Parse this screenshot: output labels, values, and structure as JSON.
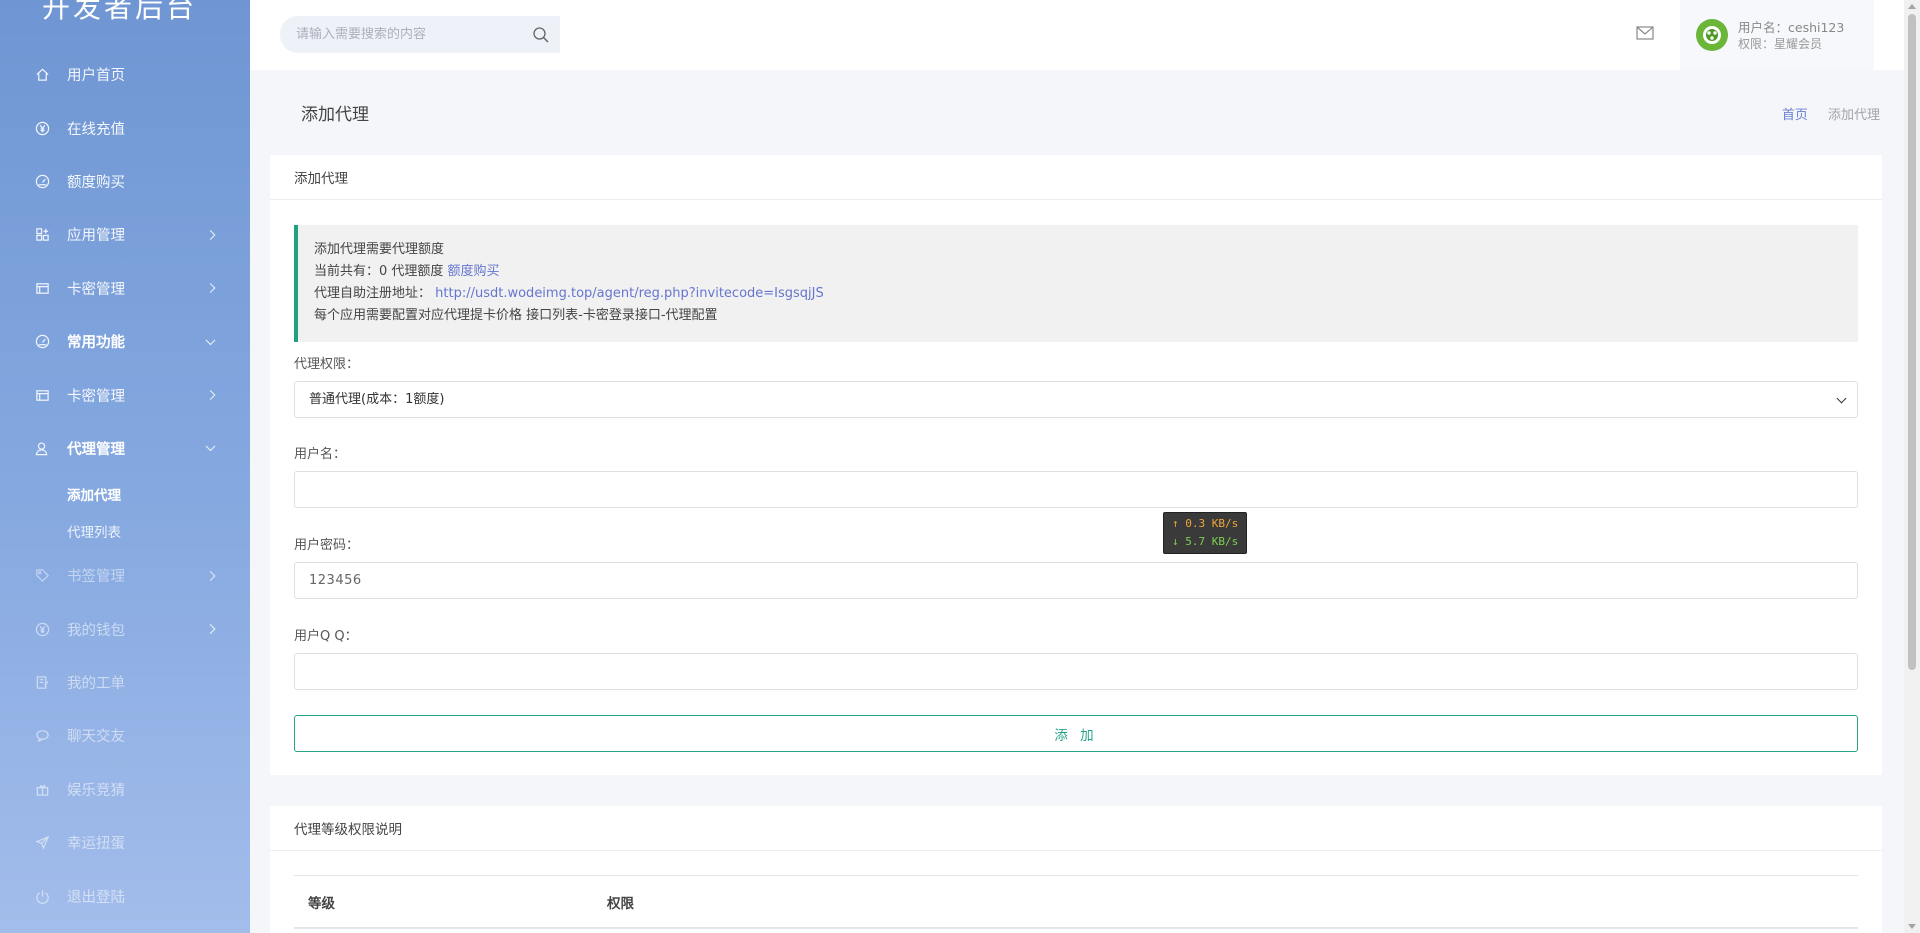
{
  "sidebar": {
    "brand": "开发者后台",
    "items": [
      {
        "label": "用户首页",
        "icon": "home-icon"
      },
      {
        "label": "在线充值",
        "icon": "yen-icon"
      },
      {
        "label": "额度购买",
        "icon": "gauge-icon"
      },
      {
        "label": "应用管理",
        "icon": "apps-icon"
      },
      {
        "label": "卡密管理",
        "icon": "card-icon"
      },
      {
        "label": "常用功能",
        "icon": "gauge-icon"
      },
      {
        "label": "卡密管理",
        "icon": "card-icon"
      },
      {
        "label": "代理管理",
        "icon": "user-icon"
      },
      {
        "label": "书签管理",
        "icon": "tag-icon"
      },
      {
        "label": "我的钱包",
        "icon": "wallet-icon"
      },
      {
        "label": "我的工单",
        "icon": "ticket-icon"
      },
      {
        "label": "聊天交友",
        "icon": "chat-icon"
      },
      {
        "label": "娱乐竞猜",
        "icon": "gift-icon"
      },
      {
        "label": "幸运扭蛋",
        "icon": "send-icon"
      },
      {
        "label": "退出登陆",
        "icon": "power-icon"
      }
    ],
    "sub_items": [
      {
        "label": "添加代理"
      },
      {
        "label": "代理列表"
      }
    ]
  },
  "header": {
    "search_placeholder": "请输入需要搜索的内容",
    "username": "用户名：ceshi123",
    "role": "权限：星耀会员"
  },
  "page": {
    "title": "添加代理",
    "breadcrumb_home": "首页",
    "breadcrumb_current": "添加代理"
  },
  "form_card": {
    "title": "添加代理",
    "notice": {
      "line1": "添加代理需要代理额度",
      "line2_prefix": "当前共有：0 代理额度 ",
      "line2_link": "额度购买",
      "line3_prefix": "代理自助注册地址：",
      "line3_link": "http://usdt.wodeimg.top/agent/reg.php?invitecode=IsgsqjJS",
      "line4": "每个应用需要配置对应代理提卡价格 接口列表-卡密登录接口-代理配置"
    },
    "level_label": "代理权限：",
    "level_selected": "普通代理(成本：1额度)",
    "username_label": "用户名：",
    "username_value": "",
    "password_label": "用户密码：",
    "password_value": "123456",
    "qq_label": "用户Q Q：",
    "qq_value": "",
    "submit_label": "添 加"
  },
  "level_card": {
    "title": "代理等级权限说明",
    "columns": [
      "等级",
      "权限"
    ]
  },
  "speed_overlay": {
    "up": "↑ 0.3 KB/s",
    "down": "↓ 5.7 KB/s"
  },
  "colors": {
    "accent_green": "#27a487",
    "link_blue": "#6576cf",
    "sidebar_top": "#6f96d3",
    "sidebar_bottom": "#a3bdeb"
  }
}
